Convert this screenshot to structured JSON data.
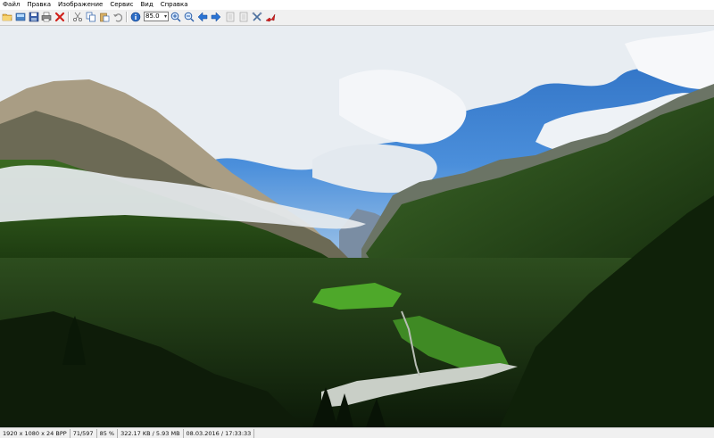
{
  "menu": {
    "items": [
      "Файл",
      "Правка",
      "Изображение",
      "Сервис",
      "Вид",
      "Справка"
    ]
  },
  "toolbar": {
    "zoom_value": "85.0",
    "icons": [
      "open-folder-icon",
      "thumbnails-icon",
      "save-icon",
      "print-icon",
      "delete-icon",
      "cut-icon",
      "copy-icon",
      "paste-icon",
      "undo-icon",
      "info-icon",
      "zoom-in-icon",
      "zoom-out-icon",
      "arrow-left-icon",
      "arrow-right-icon",
      "page-first-icon",
      "page-last-icon",
      "tools-icon",
      "exit-icon"
    ]
  },
  "statusbar": {
    "dimensions": "1920 x 1080 x 24 BPP",
    "index": "71/597",
    "zoom": "85 %",
    "size": "322.17 KB / 5.93 MB",
    "datetime": "08.03.2016 / 17:33:33"
  },
  "image": {
    "description_colors": {
      "sky": "#2f77c9",
      "cloud": "#e9eef3",
      "forest": "#1c3a14",
      "meadow": "#4ea82a"
    }
  }
}
